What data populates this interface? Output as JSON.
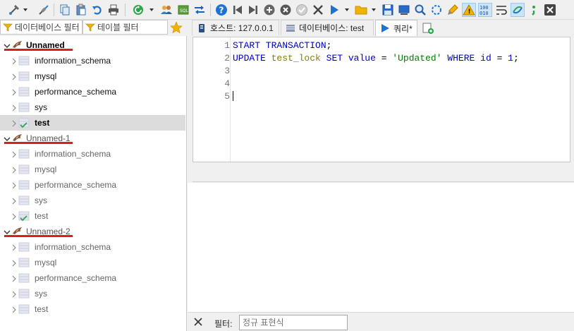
{
  "toolbar": {
    "items": [
      {
        "name": "connect-icon"
      },
      {
        "name": "disconnect-icon"
      },
      {
        "name": "copy-icon"
      },
      {
        "name": "paste-icon"
      },
      {
        "name": "undo-icon"
      },
      {
        "name": "print-icon"
      },
      {
        "name": "refresh-icon"
      },
      {
        "name": "user-manager-icon"
      },
      {
        "name": "export-icon"
      },
      {
        "name": "transfer-icon"
      },
      {
        "name": "help-icon"
      },
      {
        "name": "first-icon"
      },
      {
        "name": "last-icon"
      },
      {
        "name": "add-row-icon"
      },
      {
        "name": "delete-row-icon"
      },
      {
        "name": "post-icon"
      },
      {
        "name": "cancel-icon"
      },
      {
        "name": "run-icon"
      },
      {
        "name": "folder-icon"
      },
      {
        "name": "save-icon"
      },
      {
        "name": "explain-icon"
      },
      {
        "name": "find-icon"
      },
      {
        "name": "replace-icon"
      },
      {
        "name": "format-icon"
      },
      {
        "name": "warning-icon"
      },
      {
        "name": "binary-icon"
      },
      {
        "name": "wrap-icon"
      },
      {
        "name": "sync-icon"
      },
      {
        "name": "semicolon-icon"
      },
      {
        "name": "close-tab-icon"
      }
    ]
  },
  "filters": {
    "database_placeholder": "데이터베이스 필터",
    "table_placeholder": "테이블 필터"
  },
  "tabs": [
    {
      "label": "호스트: 127.0.0.1",
      "icon": "host-icon"
    },
    {
      "label": "데이터베이스: test",
      "icon": "database-icon"
    },
    {
      "label": "쿼리*",
      "icon": "query-icon",
      "active": true
    }
  ],
  "tree": {
    "sessions": [
      {
        "label": "Unnamed",
        "databases": [
          "information_schema",
          "mysql",
          "performance_schema",
          "sys",
          "test"
        ],
        "selected_db": "test"
      },
      {
        "label": "Unnamed-1",
        "databases": [
          "information_schema",
          "mysql",
          "performance_schema",
          "sys",
          "test"
        ]
      },
      {
        "label": "Unnamed-2",
        "databases": [
          "information_schema",
          "mysql",
          "performance_schema",
          "sys",
          "test"
        ]
      }
    ]
  },
  "editor": {
    "line_numbers": [
      "1",
      "2",
      "3",
      "4",
      "5"
    ],
    "lines": [
      [
        {
          "t": "START TRANSACTION",
          "c": "kw"
        },
        {
          "t": ";",
          "c": "plain"
        }
      ],
      [
        {
          "t": "UPDATE",
          "c": "kw"
        },
        {
          "t": " ",
          "c": "plain"
        },
        {
          "t": "test_lock",
          "c": "id"
        },
        {
          "t": " ",
          "c": "plain"
        },
        {
          "t": "SET",
          "c": "kw"
        },
        {
          "t": " ",
          "c": "plain"
        },
        {
          "t": "value",
          "c": "kw"
        },
        {
          "t": " = ",
          "c": "plain"
        },
        {
          "t": "'Updated'",
          "c": "str"
        },
        {
          "t": " ",
          "c": "plain"
        },
        {
          "t": "WHERE",
          "c": "kw"
        },
        {
          "t": " ",
          "c": "plain"
        },
        {
          "t": "id",
          "c": "kw"
        },
        {
          "t": " = ",
          "c": "plain"
        },
        {
          "t": "1",
          "c": "kw"
        },
        {
          "t": ";",
          "c": "plain"
        }
      ],
      [],
      [],
      []
    ]
  },
  "bottom": {
    "filter_label": "필터:",
    "filter_placeholder": "정규 표현식"
  },
  "colors": {
    "session_underline": "#d42020",
    "selected_row": "#dcdcdc",
    "keyword": "#0000c8",
    "identifier": "#808000",
    "string": "#008000"
  }
}
